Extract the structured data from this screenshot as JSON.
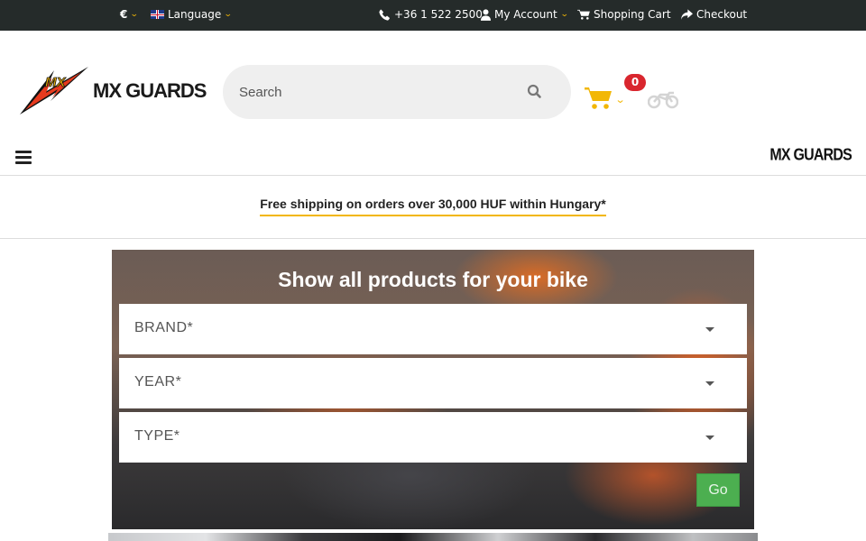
{
  "topbar": {
    "currency": "€",
    "language": "Language",
    "phone": "+36 1 522 2500",
    "account": "My Account",
    "cart": "Shopping Cart",
    "checkout": "Checkout"
  },
  "header": {
    "logo_text": "MX GUARDS",
    "logo_badge": "MX",
    "search_placeholder": "Search",
    "cart_count": "0"
  },
  "nav": {
    "brand_small": "MX GUARDS"
  },
  "promo": {
    "shipping_text": "Free shipping on orders over 30,000 HUF within Hungary*"
  },
  "bike_selector": {
    "title": "Show all products for your bike",
    "brand_label": "BRAND*",
    "year_label": "YEAR*",
    "type_label": "TYPE*",
    "go_label": "Go"
  },
  "colors": {
    "topbar_bg": "#252b2a",
    "accent_yellow": "#f2b705",
    "badge_red": "#d9262e",
    "go_green": "#4caf50"
  }
}
